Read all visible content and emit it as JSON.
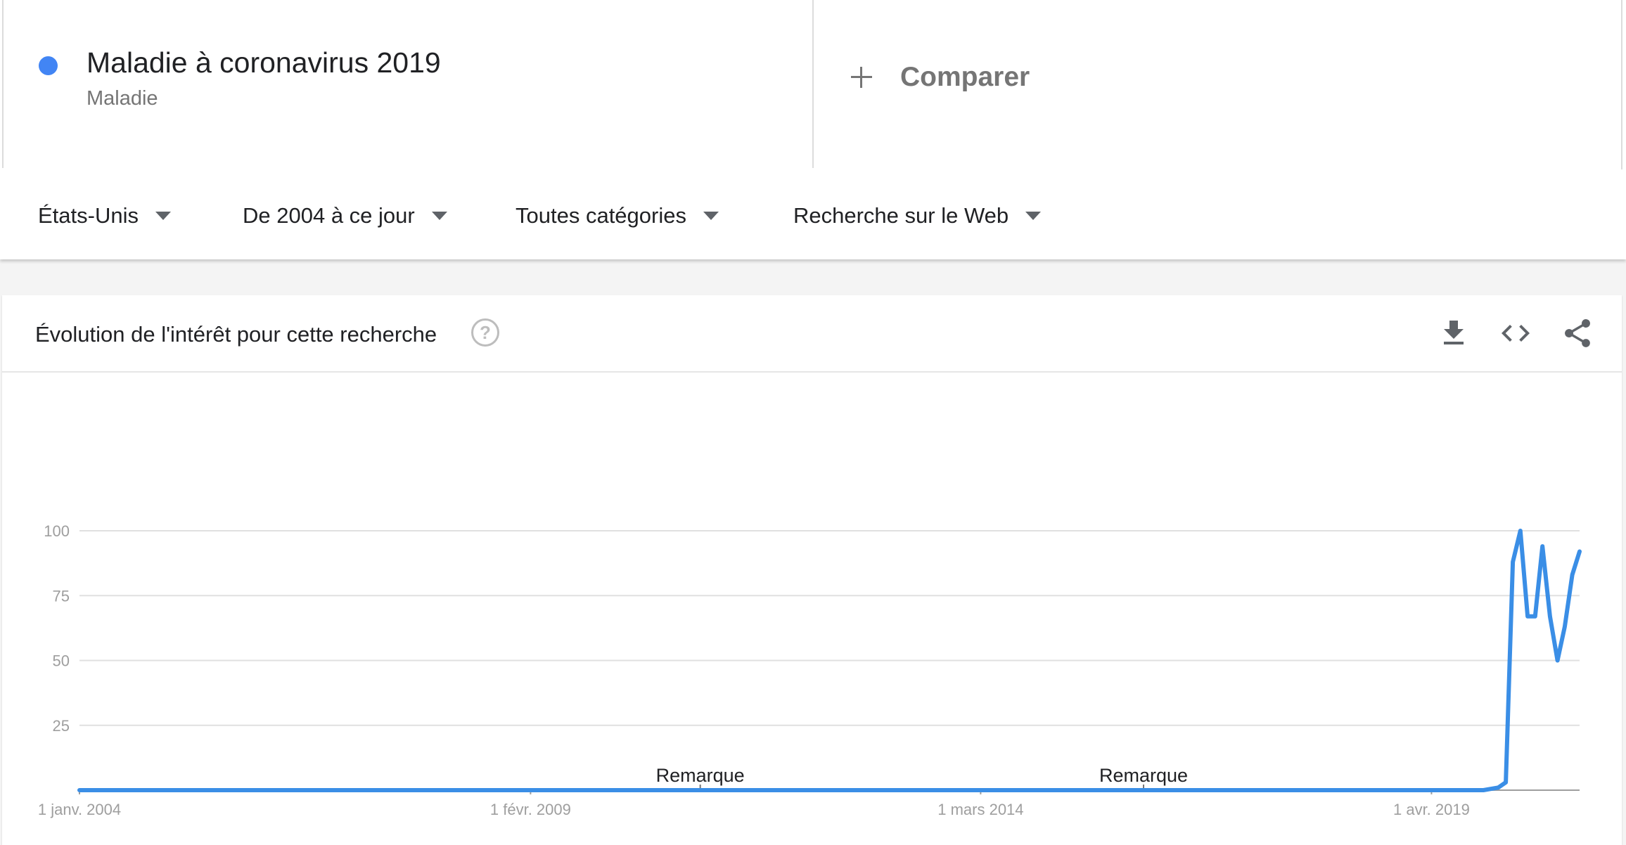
{
  "term": {
    "name": "Maladie à coronavirus 2019",
    "type": "Maladie",
    "color": "#4285f4"
  },
  "compare": {
    "label": "Comparer"
  },
  "filters": [
    {
      "label": "États-Unis"
    },
    {
      "label": "De 2004 à ce jour"
    },
    {
      "label": "Toutes catégories"
    },
    {
      "label": "Recherche sur le Web"
    }
  ],
  "card": {
    "title": "Évolution de l'intérêt pour cette recherche",
    "help": "?",
    "icons": [
      "download-icon",
      "embed-code-icon",
      "share-icon"
    ]
  },
  "chart_data": {
    "type": "line",
    "series": [
      {
        "color": "#3a8ee6",
        "points": [
          [
            "2004-01-01",
            0
          ],
          [
            "2019-11-01",
            0
          ],
          [
            "2020-01-01",
            1
          ],
          [
            "2020-02-01",
            3
          ],
          [
            "2020-03-01",
            88
          ],
          [
            "2020-04-01",
            100
          ],
          [
            "2020-05-01",
            67
          ],
          [
            "2020-06-01",
            67
          ],
          [
            "2020-07-01",
            94
          ],
          [
            "2020-08-01",
            67
          ],
          [
            "2020-09-01",
            50
          ],
          [
            "2020-10-01",
            63
          ],
          [
            "2020-11-01",
            83
          ],
          [
            "2020-12-01",
            92
          ]
        ]
      }
    ],
    "x_ticks": [
      "1 janv. 2004",
      "1 févr. 2009",
      "1 mars 2014",
      "1 avr. 2019"
    ],
    "x_tick_dates": [
      "2004-01-01",
      "2009-02-01",
      "2014-03-01",
      "2019-04-01"
    ],
    "x_range": [
      "2004-01-01",
      "2020-12-01"
    ],
    "y_ticks": [
      "25",
      "50",
      "75",
      "100"
    ],
    "ylim": [
      0,
      100
    ],
    "notes": [
      {
        "label": "Remarque",
        "date": "2011-01-01"
      },
      {
        "label": "Remarque",
        "date": "2016-01-01"
      }
    ],
    "grid": true,
    "grid_color": "#e0e0e0"
  }
}
